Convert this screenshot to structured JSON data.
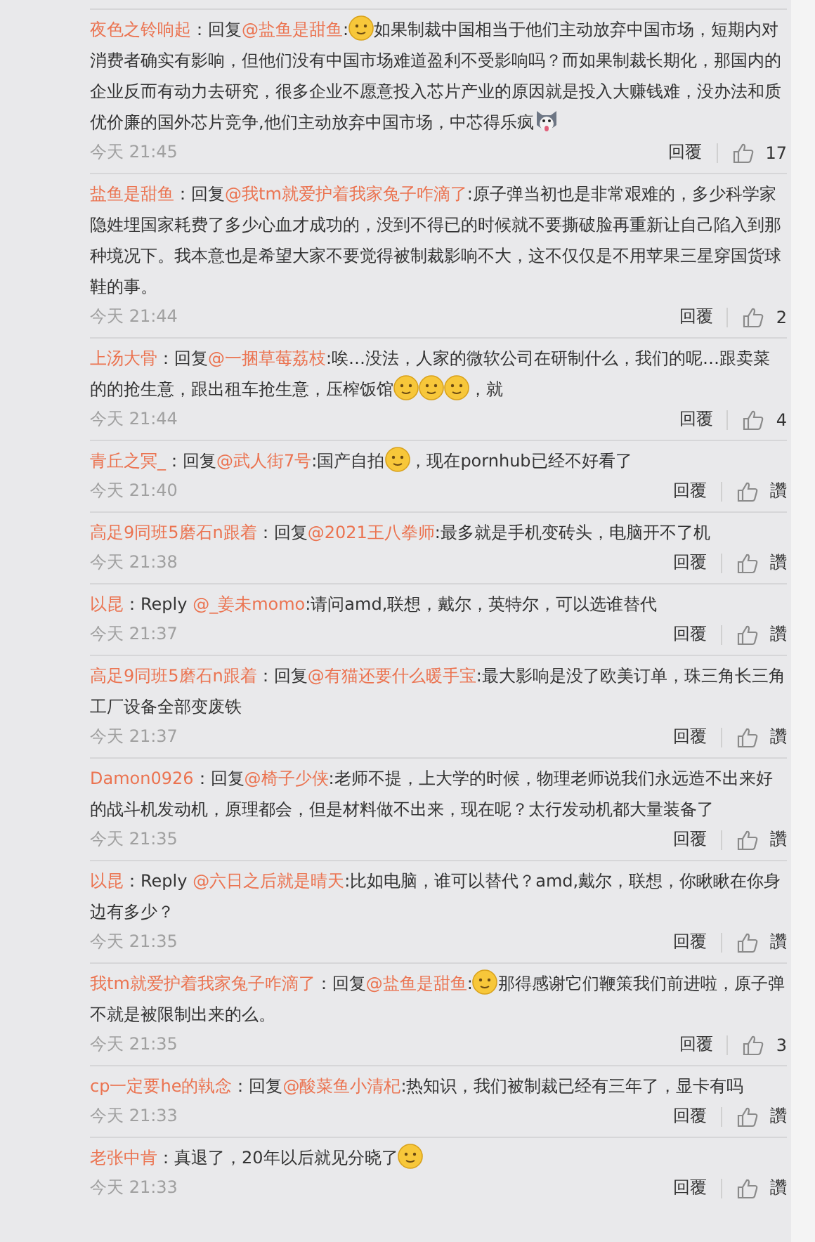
{
  "comments": [
    {
      "author": "夜色之铃响起",
      "prefix": "：回复",
      "mention": "@盐鱼是甜鱼",
      "body": [
        {
          "kind": "text",
          "text": ":"
        },
        {
          "kind": "emoji"
        },
        {
          "kind": "text",
          "text": "如果制裁中国相当于他们主动放弃中国市场，短期内对消费者确实有影响，但他们没有中国市场难道盈利不受影响吗？而如果制裁长期化，那国内的企业反而有动力去研究，很多企业不愿意投入芯片产业的原因就是投入大赚钱难，没办法和质优价廉的国外芯片竞争,他们主动放弃中国市场，中芯得乐疯"
        },
        {
          "kind": "dog"
        }
      ],
      "time": "今天 21:45",
      "reply": "回覆",
      "likes": "17"
    },
    {
      "author": "盐鱼是甜鱼",
      "prefix": "：回复",
      "mention": "@我tm就爱护着我家兔子咋滴了",
      "body": [
        {
          "kind": "text",
          "text": ":原子弹当初也是非常艰难的，多少科学家隐姓埋国家耗费了多少心血才成功的，没到不得已的时候就不要撕破脸再重新让自己陷入到那种境况下。我本意也是希望大家不要觉得被制裁影响不大，这不仅仅是不用苹果三星穿国货球鞋的事。"
        }
      ],
      "time": "今天 21:44",
      "reply": "回覆",
      "likes": "2"
    },
    {
      "author": "上汤大骨",
      "prefix": "：回复",
      "mention": "@一捆草莓荔枝",
      "body": [
        {
          "kind": "text",
          "text": ":唉…没法，人家的微软公司在研制什么，我们的呢…跟卖菜的的抢生意，跟出租车抢生意，压榨饭馆"
        },
        {
          "kind": "emoji"
        },
        {
          "kind": "emoji"
        },
        {
          "kind": "emoji"
        },
        {
          "kind": "text",
          "text": "，就"
        }
      ],
      "time": "今天 21:44",
      "reply": "回覆",
      "likes": "4"
    },
    {
      "author": "青丘之冥_",
      "prefix": "：回复",
      "mention": "@武人街7号",
      "body": [
        {
          "kind": "text",
          "text": ":国产自拍"
        },
        {
          "kind": "emoji"
        },
        {
          "kind": "text",
          "text": "，现在pornhub已经不好看了"
        }
      ],
      "time": "今天 21:40",
      "reply": "回覆",
      "likes": "讚"
    },
    {
      "author": "高足9同班5磨石n跟着",
      "prefix": "：回复",
      "mention": "@2021王八拳师",
      "body": [
        {
          "kind": "text",
          "text": ":最多就是手机变砖头，电脑开不了机"
        }
      ],
      "time": "今天 21:38",
      "reply": "回覆",
      "likes": "讚"
    },
    {
      "author": "以昆",
      "prefix": "：Reply ",
      "mention": "@_姜未momo",
      "body": [
        {
          "kind": "text",
          "text": ":请问amd,联想，戴尔，英特尔，可以选谁替代"
        }
      ],
      "time": "今天 21:37",
      "reply": "回覆",
      "likes": "讚"
    },
    {
      "author": "高足9同班5磨石n跟着",
      "prefix": "：回复",
      "mention": "@有猫还要什么暖手宝",
      "body": [
        {
          "kind": "text",
          "text": ":最大影响是没了欧美订单，珠三角长三角工厂设备全部变废铁"
        }
      ],
      "time": "今天 21:37",
      "reply": "回覆",
      "likes": "讚"
    },
    {
      "author": "Damon0926",
      "prefix": "：回复",
      "mention": "@椅子少侠",
      "body": [
        {
          "kind": "text",
          "text": ":老师不提，上大学的时候，物理老师说我们永远造不出来好的战斗机发动机，原理都会，但是材料做不出来，现在呢？太行发动机都大量装备了"
        }
      ],
      "time": "今天 21:35",
      "reply": "回覆",
      "likes": "讚"
    },
    {
      "author": "以昆",
      "prefix": "：Reply ",
      "mention": "@六日之后就是晴天",
      "body": [
        {
          "kind": "text",
          "text": ":比如电脑，谁可以替代？amd,戴尔，联想，你瞅瞅在你身边有多少？"
        }
      ],
      "time": "今天 21:35",
      "reply": "回覆",
      "likes": "讚"
    },
    {
      "author": "我tm就爱护着我家兔子咋滴了",
      "prefix": "：回复",
      "mention": "@盐鱼是甜鱼",
      "body": [
        {
          "kind": "text",
          "text": ":"
        },
        {
          "kind": "emoji"
        },
        {
          "kind": "text",
          "text": "那得感谢它们鞭策我们前进啦，原子弹不就是被限制出来的么。"
        }
      ],
      "time": "今天 21:35",
      "reply": "回覆",
      "likes": "3"
    },
    {
      "author": "cp一定要he的執念",
      "prefix": "：回复",
      "mention": "@酸菜鱼小清杞",
      "body": [
        {
          "kind": "text",
          "text": ":热知识，我们被制裁已经有三年了，显卡有吗"
        }
      ],
      "time": "今天 21:33",
      "reply": "回覆",
      "likes": "讚"
    },
    {
      "author": "老张中肯",
      "prefix": "：",
      "body": [
        {
          "kind": "text",
          "text": "真退了，20年以后就见分晓了"
        },
        {
          "kind": "emoji"
        }
      ],
      "time": "今天 21:33",
      "reply": "回覆",
      "likes": "讚"
    }
  ]
}
